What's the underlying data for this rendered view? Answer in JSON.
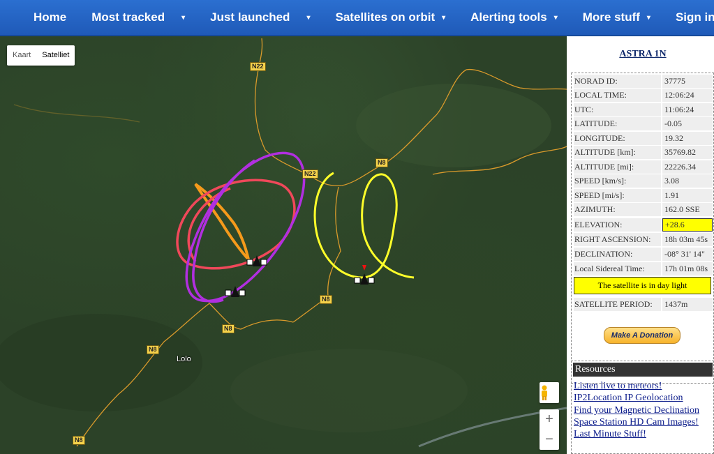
{
  "nav": {
    "items": [
      {
        "label": "Home",
        "dropdown": false
      },
      {
        "label": "Most tracked",
        "dropdown": true
      },
      {
        "label": "Just launched",
        "dropdown": true
      },
      {
        "label": "Satellites on orbit",
        "dropdown": true
      },
      {
        "label": "Alerting tools",
        "dropdown": true
      },
      {
        "label": "More stuff",
        "dropdown": true
      },
      {
        "label": "Sign in",
        "dropdown": false
      }
    ],
    "caret": "▾"
  },
  "map": {
    "type_buttons": [
      "Kaart",
      "Satelliet"
    ],
    "active_type": "Satelliet",
    "roads": [
      "N22",
      "N22",
      "N8",
      "N8",
      "N8",
      "N8",
      "N8"
    ],
    "city": "Lolo",
    "zoom_in": "+",
    "zoom_out": "−",
    "pegman_icon": "pegman-icon",
    "colors": {
      "orange_track": "#f59a1b",
      "red_track": "#f0485a",
      "purple_track": "#b12fe0",
      "yellow_track": "#ffff2a",
      "roads": "#d99a2b"
    }
  },
  "satellite": {
    "name": "ASTRA 1N",
    "fields": [
      {
        "label": "NORAD ID:",
        "value": "37775"
      },
      {
        "label": "LOCAL TIME:",
        "value": "12:06:24"
      },
      {
        "label": "UTC:",
        "value": "11:06:24"
      },
      {
        "label": "LATITUDE:",
        "value": "-0.05"
      },
      {
        "label": "LONGITUDE:",
        "value": "19.32"
      },
      {
        "label": "ALTITUDE [km]:",
        "value": "35769.82"
      },
      {
        "label": "ALTITUDE [mi]:",
        "value": "22226.34"
      },
      {
        "label": "SPEED [km/s]:",
        "value": "3.08"
      },
      {
        "label": "SPEED [mi/s]:",
        "value": "1.91"
      },
      {
        "label": "AZIMUTH:",
        "value": "162.0 SSE"
      },
      {
        "label": "ELEVATION:",
        "value": "+28.6"
      },
      {
        "label": "RIGHT ASCENSION:",
        "value": "18h 03m 45s"
      },
      {
        "label": "DECLINATION:",
        "value": "-08° 31' 14\""
      },
      {
        "label": "Local Sidereal Time:",
        "value": "17h 01m 08s"
      }
    ],
    "day_status": "The satellite is in day light",
    "period_label": "SATELLITE PERIOD:",
    "period_value": "1437m",
    "donate_label": "Make A Donation"
  },
  "resources": {
    "title": "Resources",
    "links": [
      "Listen live to meteors!",
      "IP2Location IP Geolocation",
      "Find your Magnetic Declination",
      "Space Station HD Cam Images!",
      "Last Minute Stuff!"
    ]
  }
}
